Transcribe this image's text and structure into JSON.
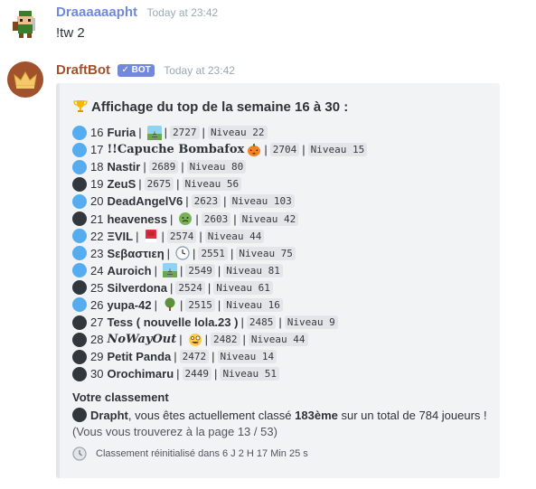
{
  "message1": {
    "username": "Draaaaaapht",
    "timestamp": "Today at 23:42",
    "content": "!tw 2"
  },
  "message2": {
    "username": "DraftBot",
    "bot_tag": "BOT",
    "timestamp": "Today at 23:42",
    "embed": {
      "title": "Affichage du top de la semaine 16 à 30 :",
      "rows": [
        {
          "rank": "16",
          "name": "Furia",
          "emoji": "rail",
          "score": "2727",
          "level": "Niveau 22",
          "circle": "blue"
        },
        {
          "rank": "17",
          "name": "!!Capuche Bombafox",
          "emoji": "pumpkin",
          "score": "2704",
          "level": "Niveau 15",
          "circle": "blue"
        },
        {
          "rank": "18",
          "name": "Nastir",
          "emoji": "",
          "score": "2689",
          "level": "Niveau 80",
          "circle": "blue"
        },
        {
          "rank": "19",
          "name": "ZeuS",
          "emoji": "",
          "score": "2675",
          "level": "Niveau 56",
          "circle": "black"
        },
        {
          "rank": "20",
          "name": "DeadAngelV6",
          "emoji": "",
          "score": "2623",
          "level": "Niveau 103",
          "circle": "blue"
        },
        {
          "rank": "21",
          "name": "heaveness",
          "emoji": "sick",
          "score": "2603",
          "level": "Niveau 42",
          "circle": "black"
        },
        {
          "rank": "22",
          "name": "ΞVIL",
          "emoji": "closed-book",
          "score": "2574",
          "level": "Niveau 44",
          "circle": "blue"
        },
        {
          "rank": "23",
          "name": "Sεβαστιεη",
          "emoji": "clock",
          "score": "2551",
          "level": "Niveau 75",
          "circle": "blue"
        },
        {
          "rank": "24",
          "name": "Auroich",
          "emoji": "rail",
          "score": "2549",
          "level": "Niveau 81",
          "circle": "blue"
        },
        {
          "rank": "25",
          "name": "Silverdona",
          "emoji": "",
          "score": "2524",
          "level": "Niveau 61",
          "circle": "black"
        },
        {
          "rank": "26",
          "name": "yupa-42",
          "emoji": "tree",
          "score": "2515",
          "level": "Niveau 16",
          "circle": "blue"
        },
        {
          "rank": "27",
          "name": "Tess ( nouvelle lola.23 )",
          "emoji": "",
          "score": "2485",
          "level": "Niveau 9",
          "circle": "black"
        },
        {
          "rank": "28",
          "name": "NoWayOut",
          "emoji": "crazy",
          "score": "2482",
          "level": "Niveau 44",
          "circle": "black"
        },
        {
          "rank": "29",
          "name": "Petit Panda",
          "emoji": "",
          "score": "2472",
          "level": "Niveau 14",
          "circle": "black"
        },
        {
          "rank": "30",
          "name": "Orochimaru",
          "emoji": "",
          "score": "2449",
          "level": "Niveau 51",
          "circle": "black"
        }
      ],
      "field_name": "Votre classement",
      "field_user": "Drapht",
      "field_text1": ", vous êtes actuellement classé ",
      "field_rank": "183ème",
      "field_text2": " sur un total de 784 joueurs !",
      "field_page": "(Vous vous trouverez à la page 13 / 53)",
      "footer": "Classement réinitialisé dans 6 J 2 H 17 Min 25 s"
    }
  },
  "colors": {
    "username1": "#7289da",
    "username2": "#a0522d",
    "bot_tag": "#7289da",
    "embed_bg": "#f2f3f5",
    "circle_blue": "#55acee",
    "circle_black": "#31373d"
  }
}
